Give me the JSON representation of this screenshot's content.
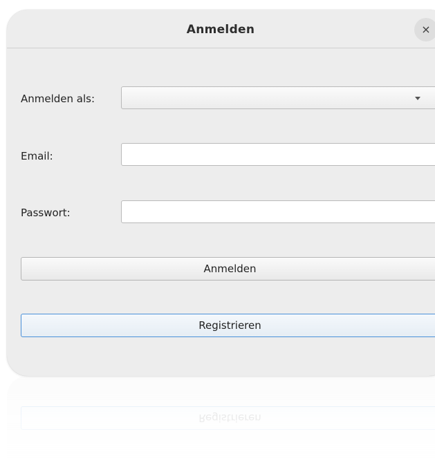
{
  "dialog": {
    "title": "Anmelden",
    "close_label": "×"
  },
  "form": {
    "login_as_label": "Anmelden als:",
    "login_as_value": "",
    "email_label": "Email:",
    "email_value": "",
    "password_label": "Passwort:",
    "password_value": ""
  },
  "buttons": {
    "login_label": "Anmelden",
    "register_label": "Registrieren"
  },
  "icons": {
    "close": "close-icon",
    "dropdown": "chevron-down-icon"
  },
  "colors": {
    "dialog_bg": "#ededed",
    "focus_border": "#4a90d9"
  }
}
